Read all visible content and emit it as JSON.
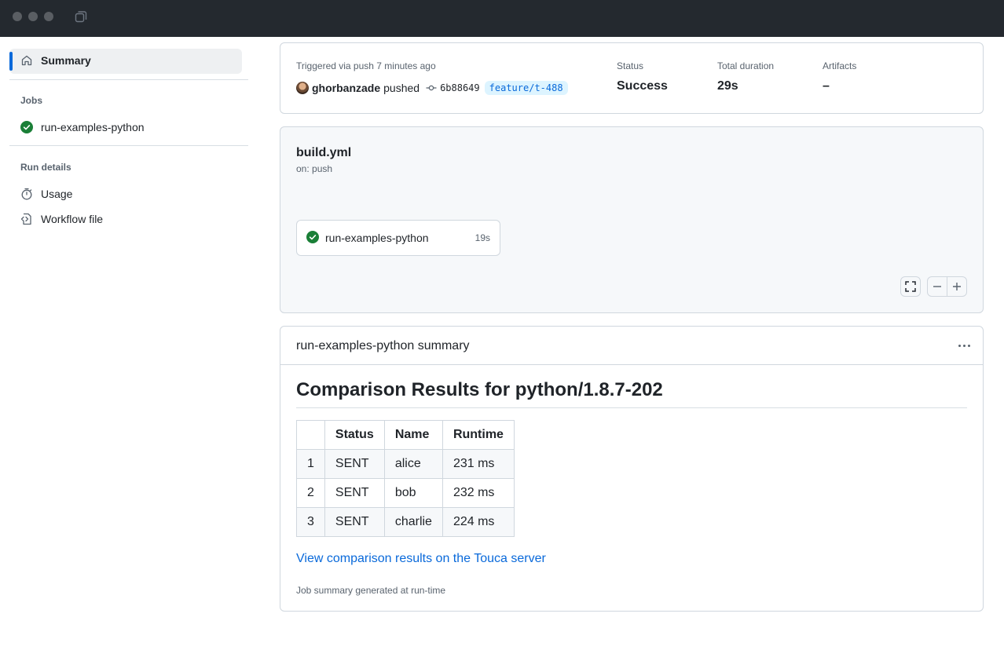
{
  "sidebar": {
    "summary_label": "Summary",
    "jobs_heading": "Jobs",
    "job_label": "run-examples-python",
    "run_details_heading": "Run details",
    "usage_label": "Usage",
    "workflow_file_label": "Workflow file"
  },
  "run": {
    "trigger_text": "Triggered via push 7 minutes ago",
    "user": "ghorbanzade",
    "action": "pushed",
    "commit_sha": "6b88649",
    "branch": "feature/t-488",
    "status_label": "Status",
    "status_value": "Success",
    "duration_label": "Total duration",
    "duration_value": "29s",
    "artifacts_label": "Artifacts",
    "artifacts_value": "–"
  },
  "workflow": {
    "name": "build.yml",
    "trigger": "on: push",
    "job_name": "run-examples-python",
    "job_duration": "19s"
  },
  "summary": {
    "title": "run-examples-python summary",
    "heading": "Comparison Results for python/1.8.7-202",
    "table": {
      "headers": [
        "",
        "Status",
        "Name",
        "Runtime"
      ],
      "rows": [
        [
          "1",
          "SENT",
          "alice",
          "231 ms"
        ],
        [
          "2",
          "SENT",
          "bob",
          "232 ms"
        ],
        [
          "3",
          "SENT",
          "charlie",
          "224 ms"
        ]
      ]
    },
    "link_text": "View comparison results on the Touca server",
    "footnote": "Job summary generated at run-time"
  },
  "colors": {
    "accent": "#0969da",
    "success": "#1a7f37",
    "titlebar": "#24292f"
  }
}
